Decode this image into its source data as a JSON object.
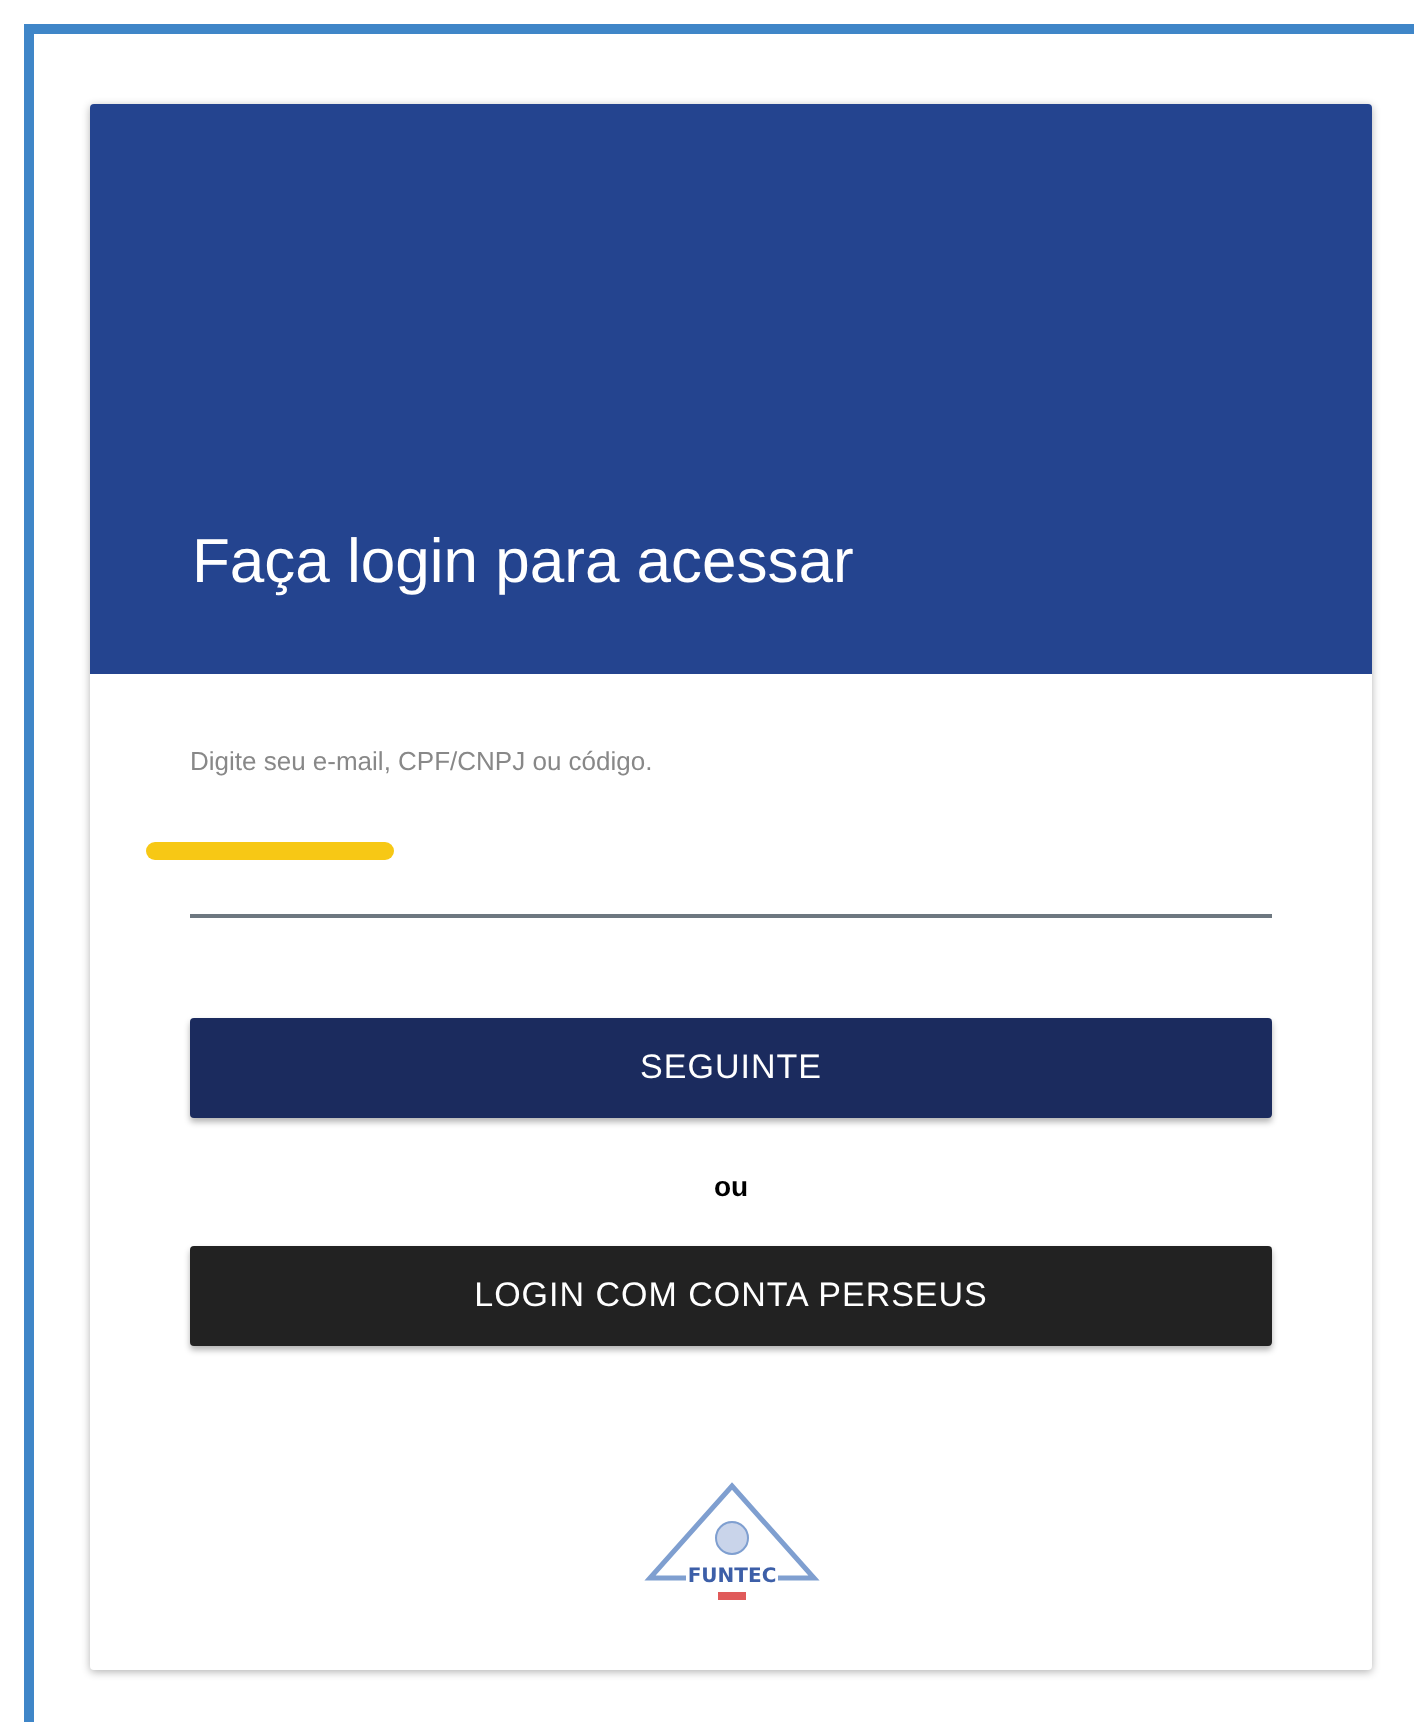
{
  "header": {
    "title": "Faça login para acessar"
  },
  "login_field": {
    "placeholder": "Digite seu e-mail, CPF/CNPJ ou código.",
    "redacted": true
  },
  "buttons": [
    {
      "label": "SEGUINTE",
      "kind": "primary"
    },
    {
      "label": "LOGIN COM CONTA PERSEUS",
      "kind": "dark"
    }
  ],
  "separator": "ou",
  "logo": {
    "text": "FUNTEC"
  }
}
